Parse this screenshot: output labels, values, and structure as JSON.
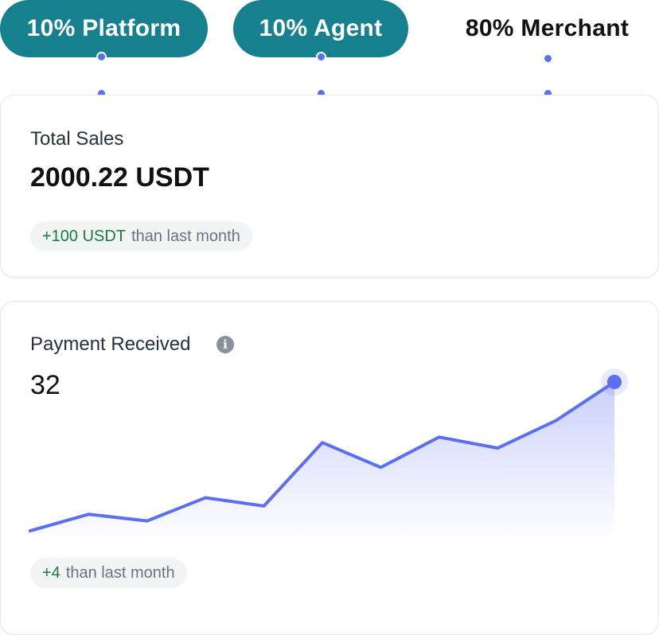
{
  "distribution": [
    {
      "label": "10% Platform",
      "style": "filled"
    },
    {
      "label": "10% Agent",
      "style": "filled"
    },
    {
      "label": "80% Merchant",
      "style": "plain"
    }
  ],
  "colors": {
    "pill": "#17808e",
    "connector": "#5b6ff0",
    "line": "#5b6ff0",
    "positive": "#168040"
  },
  "total_sales": {
    "label": "Total Sales",
    "value": "2000.22 USDT",
    "change": "+100 USDT",
    "change_suffix": "than last month"
  },
  "payment_received": {
    "label": "Payment Received",
    "info_icon": "info-icon",
    "value": "32",
    "change": "+4",
    "change_suffix": "than last month"
  },
  "chart_data": {
    "type": "area",
    "title": "",
    "xlabel": "",
    "ylabel": "",
    "x": [
      1,
      2,
      3,
      4,
      5,
      6,
      7,
      8,
      9,
      10,
      11
    ],
    "values": [
      5,
      8,
      6.8,
      11,
      9.5,
      21,
      16.5,
      22,
      20,
      25,
      32
    ],
    "ylim": [
      4,
      32
    ],
    "grid": false,
    "highlight_last_point": true
  }
}
